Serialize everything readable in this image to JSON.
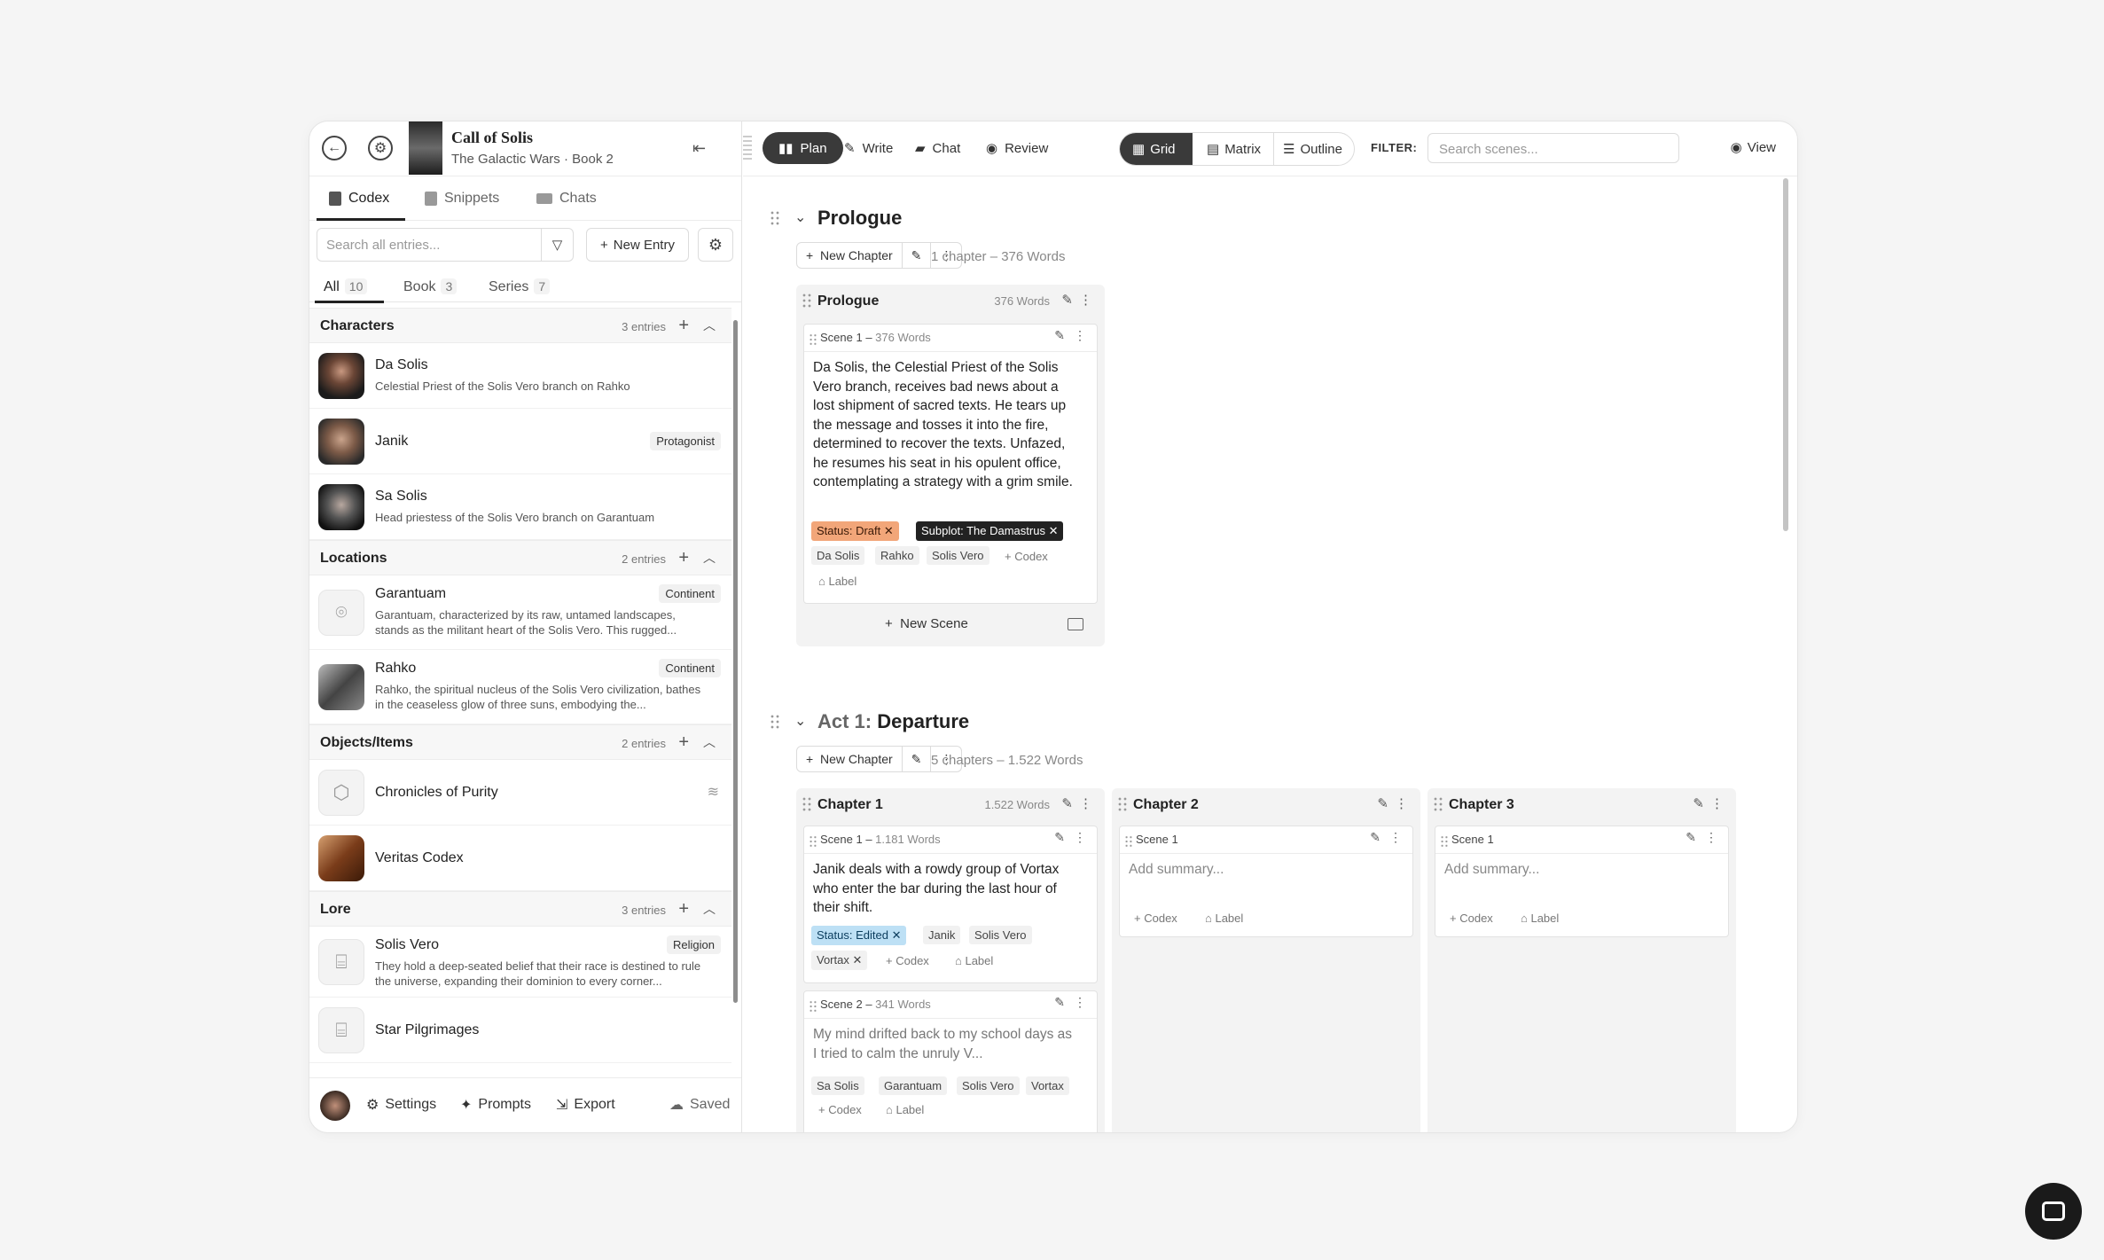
{
  "book": {
    "title": "Call of Solis",
    "subtitle": "The Galactic Wars · Book 2"
  },
  "left_tabs": [
    "Codex",
    "Snippets",
    "Chats"
  ],
  "codex_search": {
    "placeholder": "Search all entries..."
  },
  "new_entry_label": "New Entry",
  "filter_tabs": [
    {
      "label": "All",
      "count": "10"
    },
    {
      "label": "Book",
      "count": "3"
    },
    {
      "label": "Series",
      "count": "7"
    }
  ],
  "categories": [
    {
      "name": "Characters",
      "count": "3 entries",
      "entries": [
        {
          "title": "Da Solis",
          "desc": "Celestial Priest of the Solis Vero branch on Rahko",
          "badge": "",
          "avatar": "face1"
        },
        {
          "title": "Janik",
          "desc": "",
          "badge": "Protagonist",
          "avatar": "face2"
        },
        {
          "title": "Sa Solis",
          "desc": "Head priestess of the Solis Vero branch on Garantuam",
          "badge": "",
          "avatar": "face3"
        }
      ]
    },
    {
      "name": "Locations",
      "count": "2 entries",
      "entries": [
        {
          "title": "Garantuam",
          "desc": "Garantuam, characterized by its raw, untamed landscapes, stands as the militant heart of the Solis Vero. This rugged...",
          "badge": "Continent",
          "avatar": "pin"
        },
        {
          "title": "Rahko",
          "desc": "Rahko, the spiritual nucleus of the Solis Vero civilization, bathes in the ceaseless glow of three suns, embodying the...",
          "badge": "Continent",
          "avatar": "city"
        }
      ]
    },
    {
      "name": "Objects/Items",
      "count": "2 entries",
      "entries": [
        {
          "title": "Chronicles of Purity",
          "desc": "",
          "badge": "",
          "avatar": "cube"
        },
        {
          "title": "Veritas Codex",
          "desc": "",
          "badge": "",
          "avatar": "book"
        }
      ]
    },
    {
      "name": "Lore",
      "count": "3 entries",
      "entries": [
        {
          "title": "Solis Vero",
          "desc": "They hold a deep-seated belief that their race is destined to rule the universe, expanding their dominion to every corner...",
          "badge": "Religion",
          "avatar": "scroll"
        },
        {
          "title": "Star Pilgrimages",
          "desc": "",
          "badge": "",
          "avatar": "scroll"
        }
      ]
    }
  ],
  "footer": {
    "settings": "Settings",
    "prompts": "Prompts",
    "export": "Export",
    "saved": "Saved"
  },
  "topbar": {
    "modes": [
      "Plan",
      "Write",
      "Chat",
      "Review"
    ],
    "views": [
      "Grid",
      "Matrix",
      "Outline"
    ],
    "filter_label": "FILTER:",
    "search_placeholder": "Search scenes...",
    "view_label": "View"
  },
  "acts": [
    {
      "prefix": "",
      "title": "Prologue",
      "meta": "1 chapter  –  376 Words"
    },
    {
      "prefix": "Act 1:",
      "title": "Departure",
      "meta": "5 chapters  –  1.522 Words"
    }
  ],
  "new_chapter_label": "New Chapter",
  "prologue_chapter": {
    "title": "Prologue",
    "words": "376 Words",
    "scene": {
      "label": "Scene 1 –",
      "words": "376 Words",
      "text": "Da Solis, the Celestial Priest of the Solis Vero branch, receives bad news about a lost shipment of sacred texts. He tears up the message and tosses it into the fire, determined to recover the texts. Unfazed, he resumes his seat in his opulent office, contemplating a strategy with a grim smile.",
      "status": "Status: Draft",
      "subplot": "Subplot: The Damastrus",
      "tags": [
        "Da Solis",
        "Rahko",
        "Solis Vero"
      ]
    },
    "new_scene": "New Scene"
  },
  "chapters": [
    {
      "title": "Chapter 1",
      "words": "1.522 Words"
    },
    {
      "title": "Chapter 2",
      "words": ""
    },
    {
      "title": "Chapter 3",
      "words": ""
    }
  ],
  "ch1_scene1": {
    "label": "Scene 1 –",
    "words": "1.181 Words",
    "text": "Janik deals with a rowdy group of Vortax who enter the bar during the last hour of their shift.",
    "status": "Status: Edited",
    "tags": [
      "Janik",
      "Solis Vero",
      "Vortax"
    ]
  },
  "ch1_scene2": {
    "label": "Scene 2 –",
    "words": "341 Words",
    "text": "My mind drifted back to my school days as I tried to calm the unruly V...",
    "tags": [
      "Sa Solis",
      "Garantuam",
      "Solis Vero",
      "Vortax"
    ]
  },
  "empty_scene": {
    "label": "Scene 1",
    "placeholder": "Add summary..."
  },
  "codex_link": "Codex",
  "label_link": "Label"
}
